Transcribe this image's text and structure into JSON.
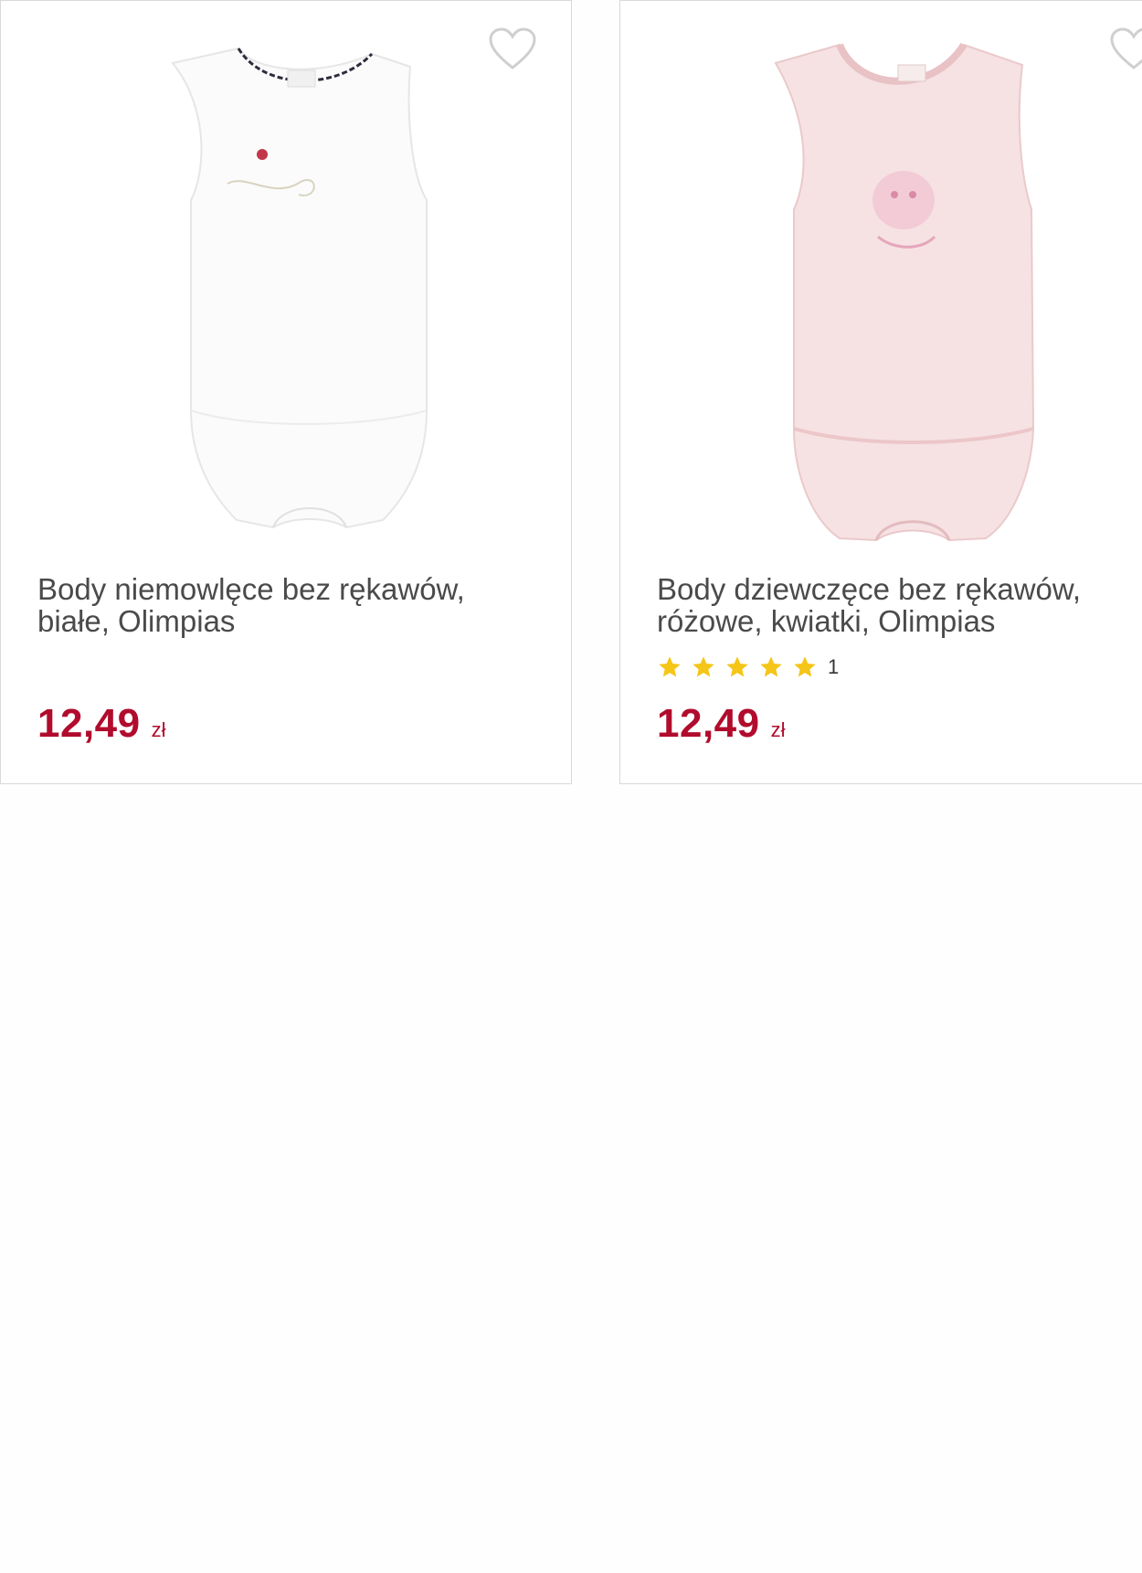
{
  "products": [
    {
      "title": "Body niemowlęce bez rękawów, białe, Olimpias",
      "price": "12,49",
      "currency": "zł",
      "rating_count": null,
      "image_color": "#fbfbfb"
    },
    {
      "title": "Body dziewczęce bez rękawów, różowe, kwiatki, Olimpias",
      "price": "12,49",
      "currency": "zł",
      "rating_count": "1",
      "rating_stars": 5,
      "image_color": "#f6e2e3"
    }
  ],
  "colors": {
    "price": "#b10c2d",
    "star": "#f5c518",
    "title": "#4a4a4a",
    "card_border": "#d9d9d9"
  },
  "icons": {
    "favorite": "heart-outline-icon",
    "rating": "star-icon"
  }
}
